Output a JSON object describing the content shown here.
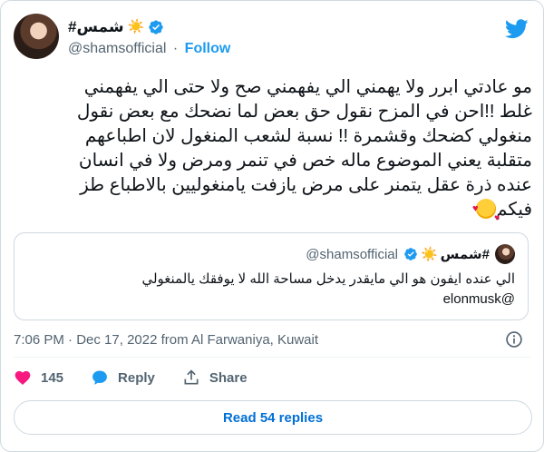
{
  "author": {
    "display_name": "#شمس",
    "sun_glyph": "☀️",
    "handle": "@shamsofficial",
    "follow_label": "Follow",
    "verified": true
  },
  "tweet": {
    "lines": [
      "مو عادتي ابرر ولا يهمني الي يفهمني صح ولا حتى الي يفهمني",
      "غلط !!احن في المزح نقول حق بعض  لما نضحك مع بعض نقول",
      "منغولي  كضحك وقشمرة !!  نسبة لشعب المنغول لان اطباعهم",
      "متقلبة يعني الموضوع ماله خص في تنمر ومرض ولا في انسان",
      "عنده ذرة عقل يتمنر على مرض يازفت يامنغوليين بالاطباع طز",
      "فيكم"
    ],
    "emoji_name": "smiling-face-with-hearts"
  },
  "quoted": {
    "display_name": "#شمس",
    "sun_glyph": "☀️",
    "handle": "@shamsofficial",
    "text": "الي عنده ايفون هو الي مايقدر يدخل مساحة     الله لا يوفقك يالمنغولي",
    "mention": "@elonmusk"
  },
  "meta": {
    "time": "7:06 PM",
    "separator": "·",
    "date": "Dec 17, 2022",
    "location": "from Al Farwaniya, Kuwait"
  },
  "actions": {
    "likes": "145",
    "reply_label": "Reply",
    "share_label": "Share"
  },
  "read_replies_label": "Read 54 replies",
  "colors": {
    "brand_blue": "#1d9bf0",
    "link_blue": "#006fd6",
    "heart_red": "#f91880",
    "muted": "#536471",
    "border": "#cfd9de"
  }
}
